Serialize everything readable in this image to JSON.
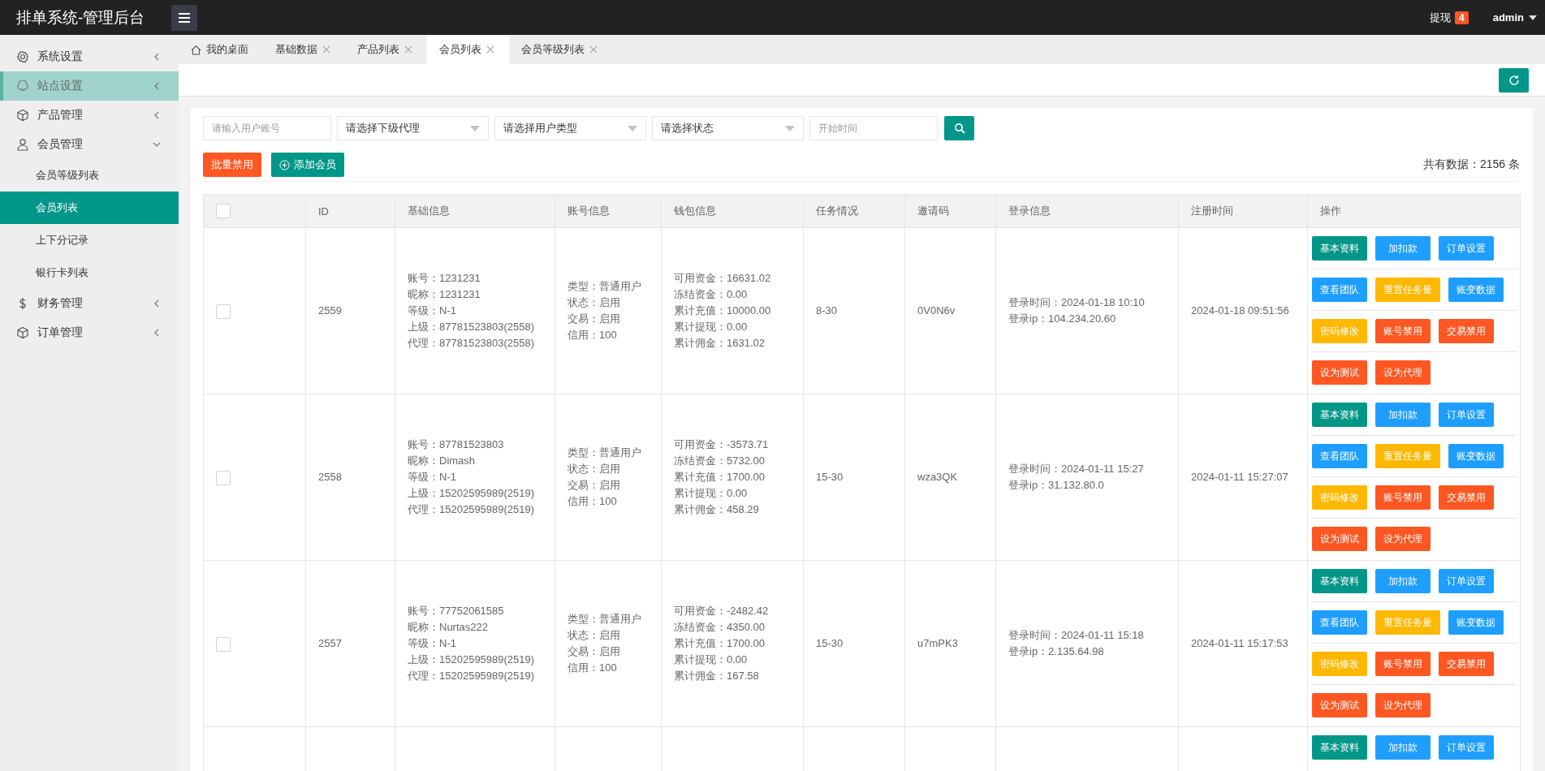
{
  "topbar": {
    "title": "排单系统-管理后台",
    "withdraw": {
      "label": "提现",
      "badge": "4"
    },
    "user": "admin"
  },
  "sidebar": {
    "items": [
      {
        "label": "系统设置",
        "expanded": false,
        "hovered": false
      },
      {
        "label": "站点设置",
        "expanded": false,
        "hovered": true
      },
      {
        "label": "产品管理",
        "expanded": false,
        "hovered": false
      },
      {
        "label": "会员管理",
        "expanded": true,
        "hovered": false,
        "children": [
          {
            "label": "会员等级列表",
            "selected": false
          },
          {
            "label": "会员列表",
            "selected": true
          },
          {
            "label": "上下分记录",
            "selected": false
          },
          {
            "label": "银行卡列表",
            "selected": false
          }
        ]
      },
      {
        "label": "财务管理",
        "expanded": false,
        "hovered": false
      },
      {
        "label": "订单管理",
        "expanded": false,
        "hovered": false
      }
    ]
  },
  "tabs": [
    {
      "label": "我的桌面",
      "kind": "home",
      "selected": false
    },
    {
      "label": "基础数据",
      "kind": "closable",
      "selected": false
    },
    {
      "label": "产品列表",
      "kind": "closable",
      "selected": false
    },
    {
      "label": "会员列表",
      "kind": "closable",
      "selected": true
    },
    {
      "label": "会员等级列表",
      "kind": "closable",
      "selected": false
    }
  ],
  "filters": [
    {
      "kind": "input",
      "placeholder": "请输入用户账号"
    },
    {
      "kind": "select",
      "value": "请选择下级代理"
    },
    {
      "kind": "select",
      "value": "请选择用户类型"
    },
    {
      "kind": "select",
      "value": "请选择状态"
    },
    {
      "kind": "input",
      "placeholder": "开始时间"
    }
  ],
  "actions": [
    {
      "label": "批量禁用",
      "kind": "danger"
    },
    {
      "label": "添加会员",
      "kind": "add"
    }
  ],
  "total": "共有数据：2156 条",
  "table": {
    "columns": [
      "ID",
      "基础信息",
      "账号信息",
      "钱包信息",
      "任务情况",
      "邀请码",
      "登录信息",
      "注册时间",
      "操作"
    ],
    "header_checked": false,
    "rows": [
      {
        "checked": false,
        "id": "2559",
        "basic": [
          "账号：1231231",
          "昵称：1231231",
          "等级：N-1",
          "上级：87781523803(2558)",
          "代理：87781523803(2558)"
        ],
        "account": [
          "类型：普通用户",
          "状态：启用",
          "交易：启用",
          "信用：100"
        ],
        "wallet": [
          "可用资金：16631.02",
          "冻结资金：0.00",
          "累计充值：10000.00",
          "累计提现：0.00",
          "累计佣金：1631.02"
        ],
        "task": "8-30",
        "invite": "0V0N6v",
        "login": [
          "登录时间：2024-01-18 10:10",
          "登录ip：104.234.20.60"
        ],
        "registered": "2024-01-18 09:51:56",
        "buttons": [
          [
            {
              "label": "基本资料",
              "kind": "primary"
            },
            {
              "label": "加扣款",
              "kind": "normal"
            },
            {
              "label": "订单设置",
              "kind": "normal"
            }
          ],
          [
            {
              "label": "查看团队",
              "kind": "normal"
            },
            {
              "label": "重置任务量",
              "kind": "warm"
            },
            {
              "label": "账变数据",
              "kind": "normal"
            }
          ],
          [
            {
              "label": "密码修改",
              "kind": "warm"
            },
            {
              "label": "账号禁用",
              "kind": "danger"
            },
            {
              "label": "交易禁用",
              "kind": "danger"
            }
          ],
          [
            {
              "label": "设为测试",
              "kind": "danger"
            },
            {
              "label": "设为代理",
              "kind": "danger"
            }
          ]
        ]
      },
      {
        "checked": false,
        "id": "2558",
        "basic": [
          "账号：87781523803",
          "昵称：Dimash",
          "等级：N-1",
          "上级：15202595989(2519)",
          "代理：15202595989(2519)"
        ],
        "account": [
          "类型：普通用户",
          "状态：启用",
          "交易：启用",
          "信用：100"
        ],
        "wallet": [
          "可用资金：-3573.71",
          "冻结资金：5732.00",
          "累计充值：1700.00",
          "累计提现：0.00",
          "累计佣金：458.29"
        ],
        "task": "15-30",
        "invite": "wza3QK",
        "login": [
          "登录时间：2024-01-11 15:27",
          "登录ip：31.132.80.0"
        ],
        "registered": "2024-01-11 15:27:07",
        "buttons": [
          [
            {
              "label": "基本资料",
              "kind": "primary"
            },
            {
              "label": "加扣款",
              "kind": "normal"
            },
            {
              "label": "订单设置",
              "kind": "normal"
            }
          ],
          [
            {
              "label": "查看团队",
              "kind": "normal"
            },
            {
              "label": "重置任务量",
              "kind": "warm"
            },
            {
              "label": "账变数据",
              "kind": "normal"
            }
          ],
          [
            {
              "label": "密码修改",
              "kind": "warm"
            },
            {
              "label": "账号禁用",
              "kind": "danger"
            },
            {
              "label": "交易禁用",
              "kind": "danger"
            }
          ],
          [
            {
              "label": "设为测试",
              "kind": "danger"
            },
            {
              "label": "设为代理",
              "kind": "danger"
            }
          ]
        ]
      },
      {
        "checked": false,
        "id": "2557",
        "basic": [
          "账号：77752061585",
          "昵称：Nurtas222",
          "等级：N-1",
          "上级：15202595989(2519)",
          "代理：15202595989(2519)"
        ],
        "account": [
          "类型：普通用户",
          "状态：启用",
          "交易：启用",
          "信用：100"
        ],
        "wallet": [
          "可用资金：-2482.42",
          "冻结资金：4350.00",
          "累计充值：1700.00",
          "累计提现：0.00",
          "累计佣金：167.58"
        ],
        "task": "15-30",
        "invite": "u7mPK3",
        "login": [
          "登录时间：2024-01-11 15:18",
          "登录ip：2.135.64.98"
        ],
        "registered": "2024-01-11 15:17:53",
        "buttons": [
          [
            {
              "label": "基本资料",
              "kind": "primary"
            },
            {
              "label": "加扣款",
              "kind": "normal"
            },
            {
              "label": "订单设置",
              "kind": "normal"
            }
          ],
          [
            {
              "label": "查看团队",
              "kind": "normal"
            },
            {
              "label": "重置任务量",
              "kind": "warm"
            },
            {
              "label": "账变数据",
              "kind": "normal"
            }
          ],
          [
            {
              "label": "密码修改",
              "kind": "warm"
            },
            {
              "label": "账号禁用",
              "kind": "danger"
            },
            {
              "label": "交易禁用",
              "kind": "danger"
            }
          ],
          [
            {
              "label": "设为测试",
              "kind": "danger"
            },
            {
              "label": "设为代理",
              "kind": "danger"
            }
          ]
        ]
      },
      {
        "buttons": [
          [
            {
              "label": "基本资料",
              "kind": "primary"
            },
            {
              "label": "加扣款",
              "kind": "normal"
            },
            {
              "label": "订单设置",
              "kind": "normal"
            }
          ]
        ]
      }
    ]
  }
}
